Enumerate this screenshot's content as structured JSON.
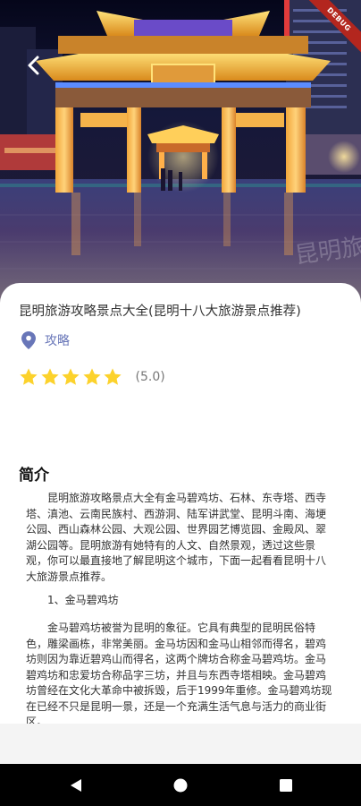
{
  "hero": {
    "image_description_icon": "paifang-gate-night-photo",
    "watermark": "昆明旅游"
  },
  "debug_banner": "DEBUG",
  "article": {
    "title": "昆明旅游攻略景点大全(昆明十八大旅游景点推荐)",
    "category": "攻略",
    "rating": {
      "stars": 5,
      "max_stars": 5,
      "score_text": "(5.0)"
    },
    "intro_heading": "简介",
    "paragraphs": [
      "昆明旅游攻略景点大全有金马碧鸡坊、石林、东寺塔、西寺塔、滇池、云南民族村、西游洞、陆军讲武堂、昆明斗南、海埂公园、西山森林公园、大观公园、世界园艺博览园、金殿风、翠湖公园等。昆明旅游有她特有的人文、自然景观，透过这些景观，你可以最直接地了解昆明这个城市，下面一起看看昆明十八大旅游景点推荐。",
      "1、金马碧鸡坊",
      "金马碧鸡坊被誉为昆明的象征。它具有典型的昆明民俗特色，雕梁画栋，非常美丽。金马坊因和金马山相邻而得名，碧鸡坊则因为靠近碧鸡山而得名，这两个牌坊合称金马碧鸡坊。金马碧鸡坊和忠爱坊合称品字三坊，并且与东西寺塔相映。金马碧鸡坊曾经在文化大革命中被拆毁，后于1999年重修。金马碧鸡坊现在已经不只是昆明一景，还是一个充满生活气息与活力的商业街区。"
    ]
  },
  "colors": {
    "accent": "#6876b8",
    "star": "#fcd22c",
    "debug": "#b3261e"
  },
  "icons": {
    "back": "chevron-left-icon",
    "location": "map-pin-icon",
    "star": "star-icon",
    "nav_back": "triangle-back-icon",
    "nav_home": "circle-home-icon",
    "nav_recent": "square-recent-icon"
  }
}
